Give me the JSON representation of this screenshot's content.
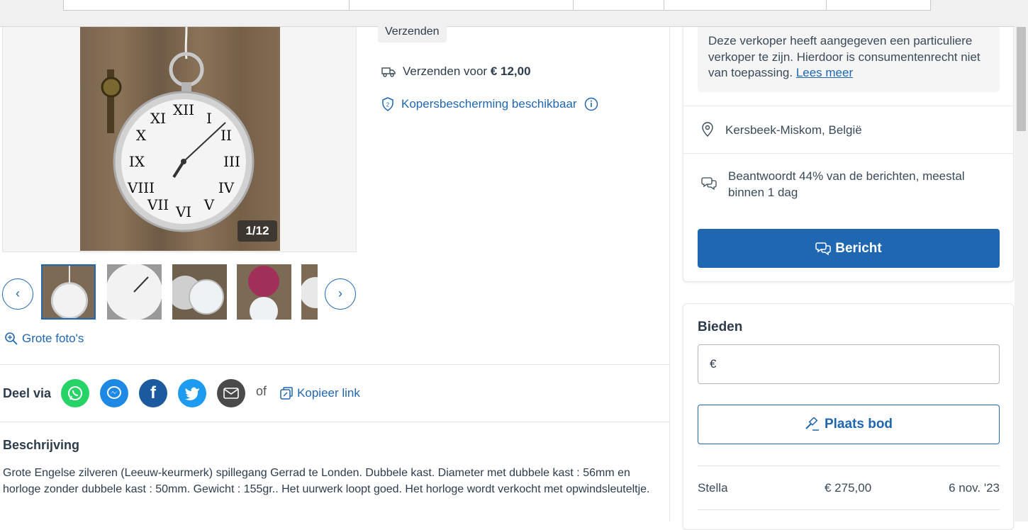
{
  "shipping": {
    "tag": "Verzenden",
    "price_prefix": "Verzenden voor ",
    "price": "€ 12,00",
    "protection": "Kopersbescherming beschikbaar"
  },
  "gallery": {
    "counter": "1/12",
    "large_photos": "Grote foto's"
  },
  "share": {
    "label": "Deel via",
    "or": "of",
    "copy_link": "Kopieer link",
    "colors": {
      "whatsapp": "#25d366",
      "messenger": "#1e88e5",
      "facebook": "#1b5a9e",
      "twitter": "#1d9bf0",
      "email": "#4a4a4a"
    }
  },
  "description": {
    "heading": "Beschrijving",
    "text": "Grote Engelse zilveren (Leeuw-keurmerk) spillegang Gerrad te Londen. Dubbele kast. Diameter met dubbele kast : 56mm en horloge zonder dubbele kast : 50mm. Gewicht : 155gr.. Het uurwerk loopt goed. Het horloge wordt verkocht met opwindsleuteltje."
  },
  "seller": {
    "notice": "Deze verkoper heeft aangegeven een particuliere verkoper te zijn. Hierdoor is consumentenrecht niet van toepassing. ",
    "notice_link": "Lees meer",
    "location": "Kersbeek-Miskom, België",
    "response": "Beantwoordt 44% van de berichten, meestal binnen 1 dag",
    "message_button": "Bericht"
  },
  "bidding": {
    "heading": "Bieden",
    "currency": "€",
    "input_value": "",
    "place_button": "Plaats bod",
    "bids": [
      {
        "name": "Stella",
        "amount": "€ 275,00",
        "date": "6 nov. '23"
      }
    ]
  },
  "accent_color": "#1f67b0"
}
